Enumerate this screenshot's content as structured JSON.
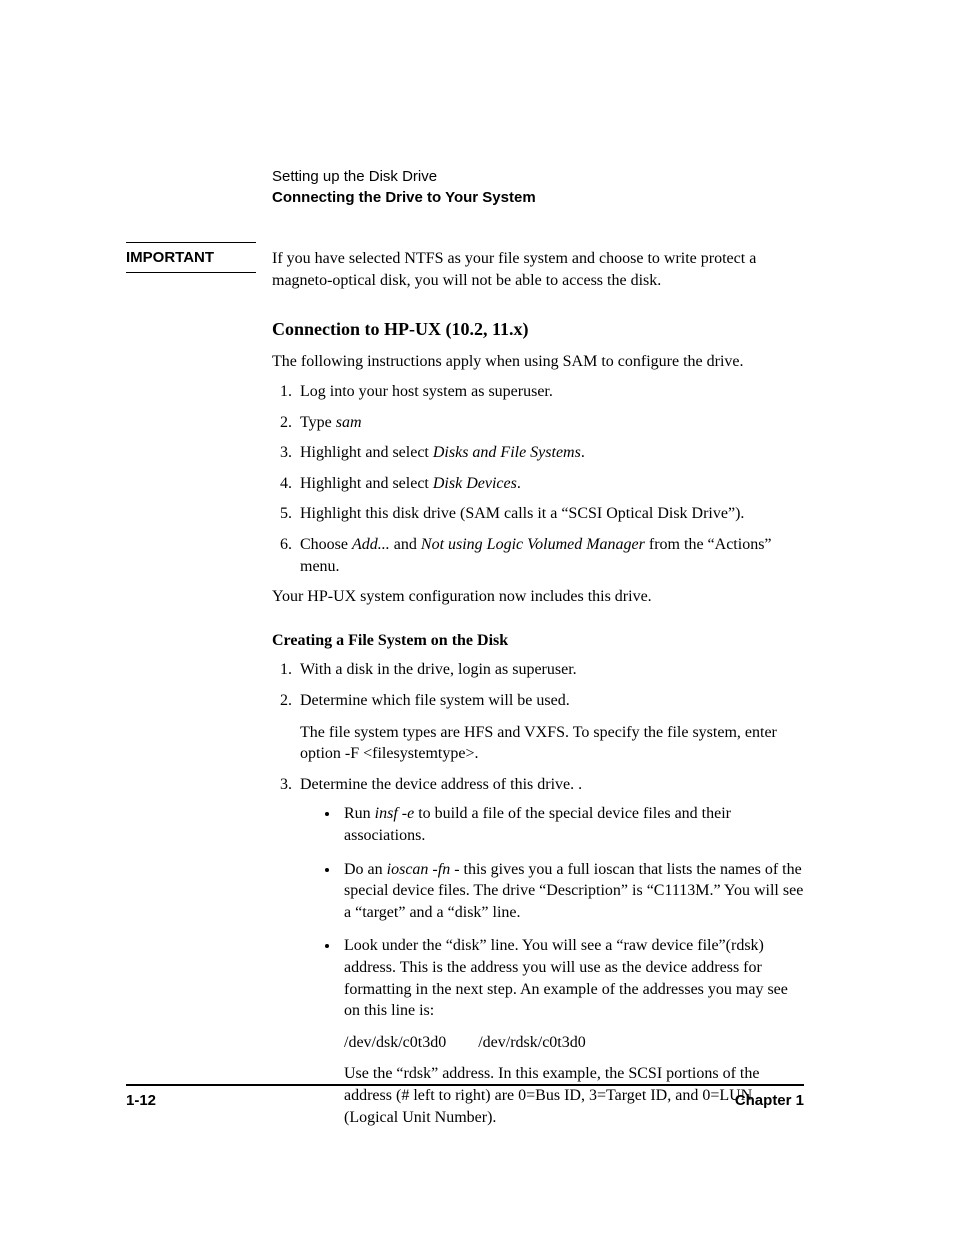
{
  "header": {
    "chapter_title": "Setting up the Disk Drive",
    "section_title": "Connecting the Drive to Your System"
  },
  "important": {
    "label": "IMPORTANT",
    "text": "If you have selected NTFS as your file system and choose to write protect a magneto-optical disk, you will not be able to access the disk."
  },
  "section1": {
    "heading": "Connection to HP-UX (10.2, 11.x)",
    "intro": "The following instructions apply when using SAM to configure the drive.",
    "steps": {
      "s1": "Log into your host system as superuser.",
      "s2_pre": "Type ",
      "s2_em": "sam",
      "s3_pre": "Highlight and select ",
      "s3_em": "Disks and File Systems",
      "s3_post": ".",
      "s4_pre": "Highlight and select ",
      "s4_em": "Disk Devices",
      "s4_post": ".",
      "s5": "Highlight this disk drive (SAM calls it a “SCSI Optical Disk Drive”).",
      "s6_pre": "Choose ",
      "s6_em1": "Add...",
      "s6_mid": " and ",
      "s6_em2": "Not using Logic Volumed Manager",
      "s6_post": " from the “Actions” menu."
    },
    "closing": "Your HP-UX system configuration now includes this drive."
  },
  "section2": {
    "heading": "Creating a File System on the Disk",
    "steps": {
      "s1": "With a disk in the drive, login as superuser.",
      "s2": "Determine which file system will be used.",
      "s2_sub": "The file system types are HFS and VXFS. To specify the file system, enter option -F <filesystemtype>.",
      "s3": "Determine the device address of this drive. .",
      "bullets": {
        "b1_pre": "Run ",
        "b1_em": "insf -e",
        "b1_post": " to build a file of the special device files and their associations.",
        "b2_pre": "Do an ",
        "b2_em": "ioscan -fn",
        "b2_post": " - this gives you a full ioscan that lists the names of the special device files. The drive “Description” is “C1113M.” You will see a “target” and a “disk” line.",
        "b3": "Look under the “disk” line. You will see a “raw device file”(rdsk) address. This is the address you will use as the device address for formatting in the next step. An example of the addresses you may see on this line is:",
        "b3_example": "/dev/dsk/c0t3d0  /dev/rdsk/c0t3d0",
        "b3_note": "Use the “rdsk” address. In this example, the SCSI portions of the address (# left to right) are 0=Bus ID, 3=Target ID, and 0=LUN (Logical Unit Number)."
      }
    }
  },
  "footer": {
    "page_num": "1-12",
    "chapter": "Chapter 1"
  }
}
